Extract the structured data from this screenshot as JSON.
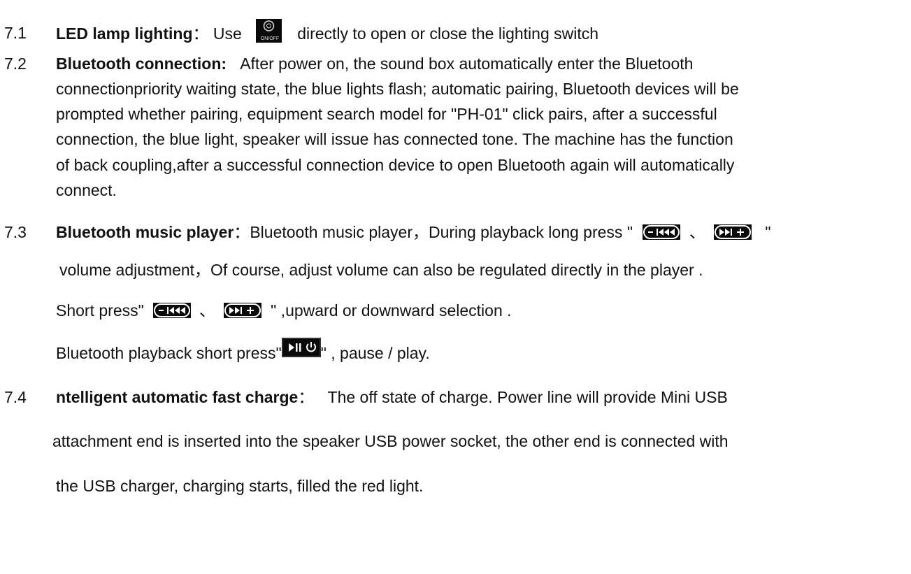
{
  "s71": {
    "num": "7.1",
    "title": "LED lamp lighting",
    "sep": "：",
    "pre": "Use",
    "icon": "on-off-lamp-button-icon",
    "icon_text": "ON/OFF",
    "post": "directly to open or close the lighting switch"
  },
  "s72": {
    "num": "7.2",
    "title": "Bluetooth connection:",
    "lines": [
      "After power on, the sound box automatically enter the Bluetooth",
      "connectionpriority waiting state, the blue lights flash; automatic pairing, Bluetooth devices will be",
      "prompted whether pairing, equipment search model for \"PH-01\" click pairs, after a successful",
      "connection, the blue light, speaker will issue has connected tone. The machine has the function",
      "of back coupling,after a successful connection device to open Bluetooth again will automatically",
      "connect."
    ]
  },
  "s73": {
    "num": "7.3",
    "title": "Bluetooth music player",
    "sep": "：",
    "text1": "Bluetooth music player，During playback long press \"",
    "sep2": "、",
    "close_quote": "\"",
    "line2": "volume adjustment，Of course, adjust volume can also be regulated directly in the player .",
    "line3_pre": "Short press\"",
    "line3_post": "\" ,upward or downward selection .",
    "line4_pre": "Bluetooth playback short press\"",
    "line4_post": "\" , pause / play.",
    "icons": {
      "prev": "minus-previous-button-icon",
      "next": "next-plus-button-icon",
      "play": "play-pause-power-button-icon"
    }
  },
  "s74": {
    "num": "7.4",
    "title": "ntelligent automatic fast charge",
    "sep": "：",
    "line1": "The off state of charge. Power line will provide Mini USB",
    "line2": "attachment end is inserted into the speaker USB power socket, the other end is connected with",
    "line3": "the USB charger, charging starts, filled the red light."
  }
}
